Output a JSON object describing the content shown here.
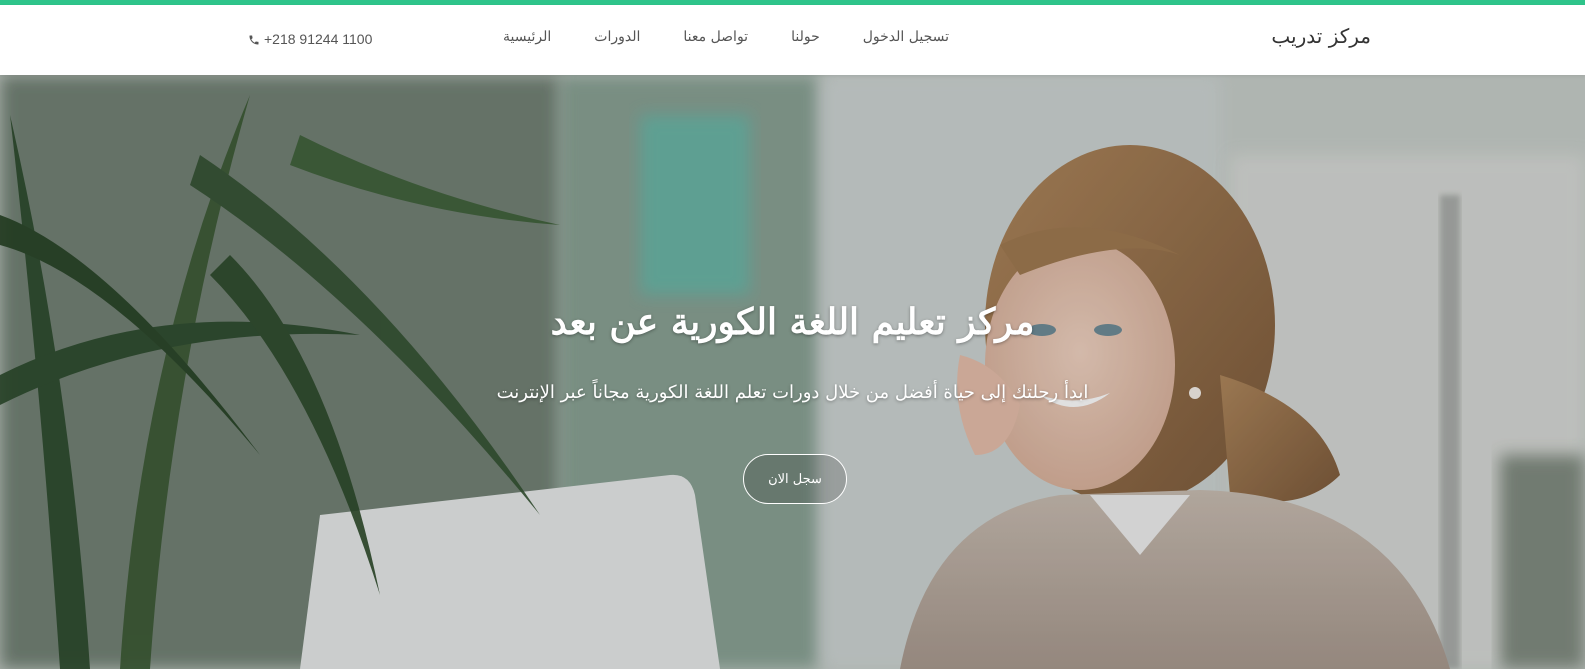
{
  "header": {
    "brand": "مركز تدريب",
    "nav_items": [
      {
        "label": "الرئيسية"
      },
      {
        "label": "الدورات"
      },
      {
        "label": "تواصل معنا"
      },
      {
        "label": "حولنا"
      },
      {
        "label": "تسجيل الدخول"
      }
    ],
    "phone": "+218 91244 1100",
    "phone_icon": "phone-icon",
    "accent_color": "#2ec48a"
  },
  "hero": {
    "title": "مركز تعليم اللغة الكورية عن بعد",
    "subtitle": "ابدأ رحلتك إلى حياة أفضل من خلال دورات تعلم اللغة الكورية مجاناً عبر الإنترنت",
    "cta_label": "سجل الان"
  }
}
